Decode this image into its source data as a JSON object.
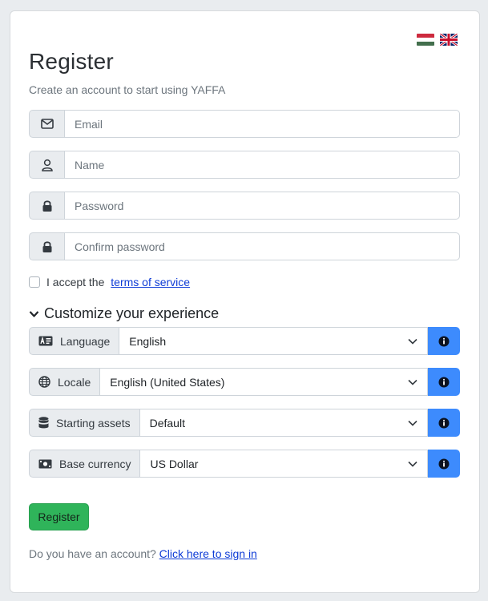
{
  "header": {
    "flags": [
      {
        "name": "hungarian-flag",
        "colors": [
          "#cd2a3e",
          "#ffffff",
          "#436f4d"
        ]
      },
      {
        "name": "english-flag",
        "colors": [
          "#012169",
          "#ffffff",
          "#c8102e"
        ]
      }
    ],
    "title": "Register",
    "subtitle": "Create an account to start using YAFFA"
  },
  "form": {
    "email": {
      "icon": "envelope-icon",
      "placeholder": "Email"
    },
    "name": {
      "icon": "user-icon",
      "placeholder": "Name"
    },
    "password": {
      "icon": "lock-icon",
      "placeholder": "Password"
    },
    "confirm_password": {
      "icon": "lock-icon",
      "placeholder": "Confirm password"
    },
    "terms": {
      "prefix": "I accept the ",
      "link": "terms of service"
    }
  },
  "customize": {
    "heading": "Customize your experience",
    "fields": [
      {
        "key": "language",
        "icon": "id-card-icon",
        "label": "Language",
        "value": "English"
      },
      {
        "key": "locale",
        "icon": "globe-icon",
        "label": "Locale",
        "value": "English (United States)"
      },
      {
        "key": "starting-assets",
        "icon": "database-icon",
        "label": "Starting assets",
        "value": "Default"
      },
      {
        "key": "base-currency",
        "icon": "money-bill-icon",
        "label": "Base currency",
        "value": "US Dollar"
      }
    ]
  },
  "actions": {
    "register_label": "Register",
    "signin_prefix": "Do you have an account? ",
    "signin_link": "Click here to sign in"
  },
  "colors": {
    "accent_info": "#3d8bfd",
    "register_green": "#2fb45a",
    "link": "#0d3bd6"
  }
}
